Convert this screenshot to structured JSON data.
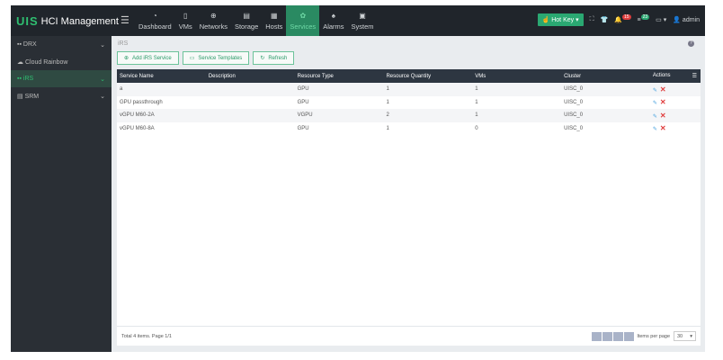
{
  "header": {
    "logo": "UIS",
    "title": "HCI Management",
    "nav": [
      {
        "label": "Dashboard",
        "icon": "◔"
      },
      {
        "label": "VMs",
        "icon": "▯"
      },
      {
        "label": "Networks",
        "icon": "⊕"
      },
      {
        "label": "Storage",
        "icon": "▤"
      },
      {
        "label": "Hosts",
        "icon": "▦"
      },
      {
        "label": "Services",
        "icon": "✿"
      },
      {
        "label": "Alarms",
        "icon": "♠"
      },
      {
        "label": "System",
        "icon": "▣"
      }
    ],
    "hotkey": "Hot Key",
    "alarm_count": "15",
    "task_count": "23",
    "user": "admin"
  },
  "sidebar": {
    "items": [
      {
        "label": "DRX",
        "icon": "▪▪"
      },
      {
        "label": "Cloud Rainbow",
        "icon": "☁"
      },
      {
        "label": "iRS",
        "icon": "▪▪"
      },
      {
        "label": "SRM",
        "icon": "▤"
      }
    ]
  },
  "breadcrumb": "iRS",
  "toolbar": {
    "add": "Add iRS Service",
    "templates": "Service Templates",
    "refresh": "Refresh"
  },
  "table": {
    "columns": [
      "Service Name",
      "Description",
      "Resource Type",
      "Resource Quantity",
      "VMs",
      "Cluster",
      "Actions"
    ],
    "rows": [
      [
        "a",
        "",
        "GPU",
        "1",
        "1",
        "UISC_0"
      ],
      [
        "GPU passthrough",
        "",
        "GPU",
        "1",
        "1",
        "UISC_0"
      ],
      [
        "vGPU M60-2A",
        "",
        "VGPU",
        "2",
        "1",
        "UISC_0"
      ],
      [
        "vGPU M60-8A",
        "",
        "GPU",
        "1",
        "0",
        "UISC_0"
      ]
    ]
  },
  "footer": {
    "summary": "Total 4 items. Page 1/1",
    "per_page_label": "Items per page",
    "per_page": "30"
  }
}
